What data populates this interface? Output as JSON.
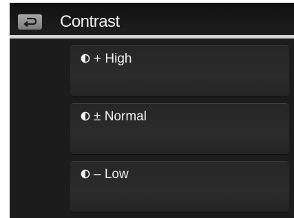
{
  "header": {
    "title": "Contrast",
    "back_icon": "back-arrow-icon"
  },
  "options": [
    {
      "label": "+ High",
      "icon": "contrast-icon"
    },
    {
      "label": "± Normal",
      "icon": "contrast-icon"
    },
    {
      "label": "– Low",
      "icon": "contrast-icon"
    }
  ],
  "colors": {
    "background": "#1c1c1c",
    "divider": "#d4d4d4",
    "text": "#f2f2f2",
    "button": "#8f8f8f"
  }
}
